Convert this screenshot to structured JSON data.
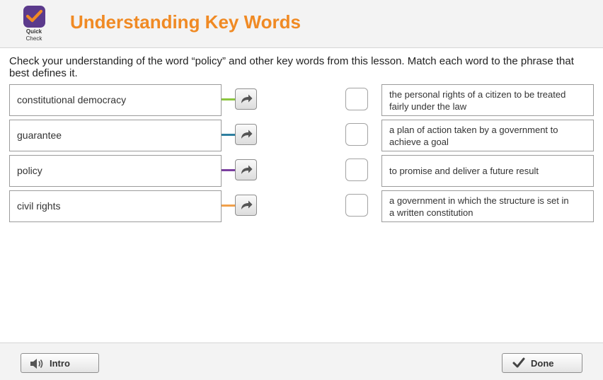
{
  "header": {
    "logo_line1": "Quick",
    "logo_line2": "Check",
    "title": "Understanding Key Words",
    "accent_color": "#f08a24",
    "logo_color": "#5b3a8c"
  },
  "instructions": "Check your understanding of the word “policy” and other key words from this lesson. Match each word to the phrase that best defines it.",
  "terms": [
    {
      "label": "constitutional democracy",
      "connector_color": "#8cc63f"
    },
    {
      "label": "guarantee",
      "connector_color": "#2e7fa0"
    },
    {
      "label": "policy",
      "connector_color": "#7b3fa0"
    },
    {
      "label": "civil rights",
      "connector_color": "#f0a04b"
    }
  ],
  "definitions": [
    {
      "label": "the personal rights of a citizen to be treated fairly under the law"
    },
    {
      "label": "a plan of action taken by a government to achieve a goal"
    },
    {
      "label": "to promise and deliver a future result"
    },
    {
      "label": "a government in which the structure is set in a written constitution"
    }
  ],
  "footer": {
    "intro_label": "Intro",
    "done_label": "Done"
  },
  "icons": {
    "logo": "checkmark-icon",
    "arrow": "curved-arrow-icon",
    "intro": "speaker-icon",
    "done": "checkmark-icon"
  }
}
